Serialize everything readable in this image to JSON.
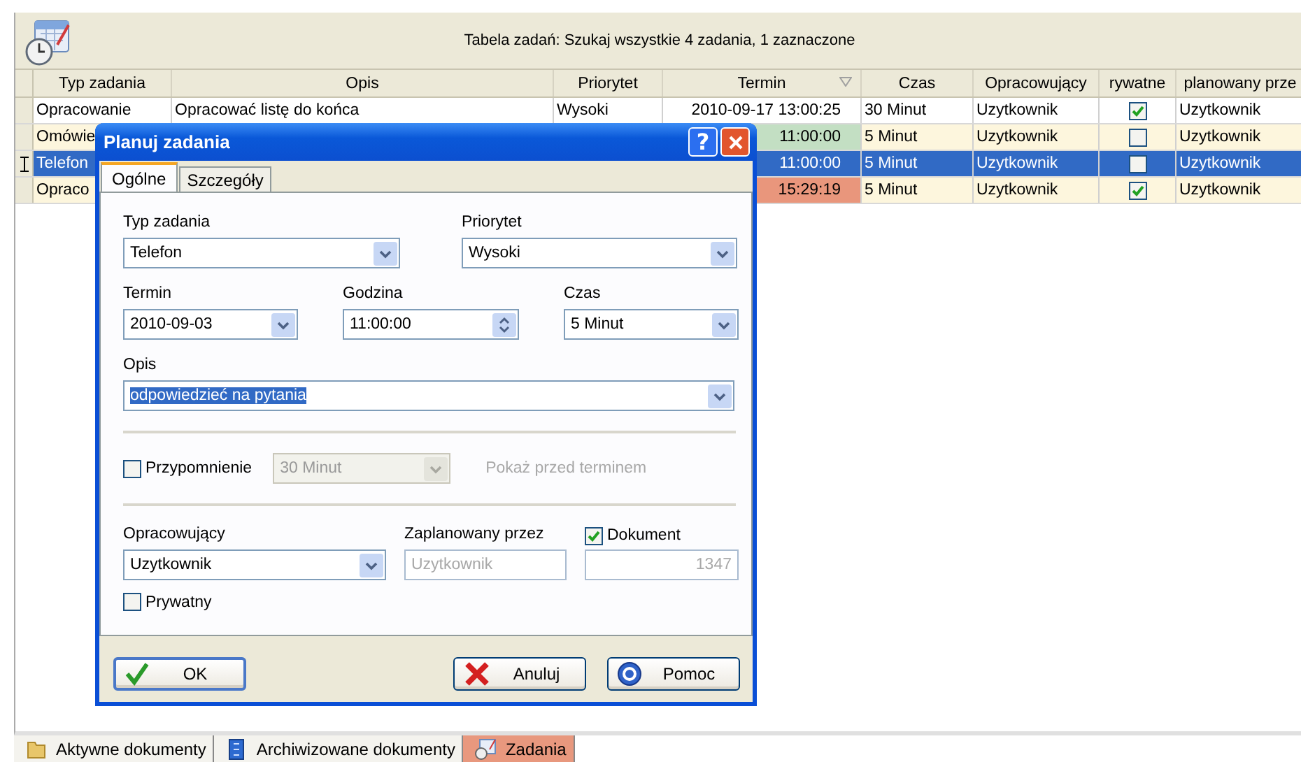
{
  "header": {
    "title": "Tabela zadań: Szukaj wszystkie 4 zadania, 1 zaznaczone"
  },
  "table": {
    "columns": [
      {
        "label": "Typ zadania",
        "sorted": false
      },
      {
        "label": "Opis",
        "sorted": false
      },
      {
        "label": "Priorytet",
        "sorted": false
      },
      {
        "label": "Termin",
        "sorted": true
      },
      {
        "label": "Czas",
        "sorted": false
      },
      {
        "label": "Opracowujący",
        "sorted": false
      },
      {
        "label": "rywatne",
        "sorted": false
      },
      {
        "label": "planowany prze",
        "sorted": false
      }
    ],
    "rows": [
      {
        "typ": "Opracowanie",
        "opis": "Opracować listę do końca",
        "priorytet": "Wysoki",
        "termin": "2010-09-17 13:00:25",
        "czas": "30 Minut",
        "opracowujacy": "Uzytkownik",
        "prywatne": true,
        "planowany": "Uzytkownik",
        "selected": false,
        "current": false
      },
      {
        "typ": "Omówie",
        "termin": "11:00:00",
        "color": "#c3dfc3",
        "czas": "5 Minut",
        "opracowujacy": "Uzytkownik",
        "prywatne": false,
        "planowany": "Uzytkownik",
        "selected": false,
        "current": false
      },
      {
        "typ": "Telefon",
        "termin": "11:00:00",
        "czas": "5 Minut",
        "opracowujacy": "Uzytkownik",
        "prywatne": false,
        "planowany": "Uzytkownik",
        "selected": true,
        "current": true
      },
      {
        "typ": "Opraco",
        "termin": "15:29:19",
        "color": "#e9967c",
        "czas": "5 Minut",
        "opracowujacy": "Uzytkownik",
        "prywatne": true,
        "planowany": "Uzytkownik",
        "selected": false,
        "current": false
      }
    ]
  },
  "dialog": {
    "title": "Planuj zadania",
    "help": "?",
    "tabs": [
      {
        "label": "Ogólne",
        "selected": true
      },
      {
        "label": "Szczegóły",
        "selected": false
      }
    ],
    "typ": {
      "label": "Typ zadania",
      "value": "Telefon"
    },
    "priorytet": {
      "label": "Priorytet",
      "value": "Wysoki"
    },
    "termin": {
      "label": "Termin",
      "value": "2010-09-03"
    },
    "godzina": {
      "label": "Godzina",
      "value": "11:00:00"
    },
    "czas": {
      "label": "Czas",
      "value": "5 Minut"
    },
    "opis": {
      "label": "Opis",
      "value": "odpowiedzieć na pytania"
    },
    "reminder": {
      "label": "Przypomnienie",
      "checked": false,
      "value": "30 Minut",
      "note": "Pokaż przed terminem"
    },
    "opracowujacy": {
      "label": "Opracowujący",
      "value": "Uzytkownik"
    },
    "zaplanowany": {
      "label": "Zaplanowany przez",
      "value": "Uzytkownik",
      "disabled": true
    },
    "dokument": {
      "label": "Dokument",
      "checked": true,
      "value": "1347",
      "disabled": true
    },
    "prywatny": {
      "label": "Prywatny",
      "checked": false
    },
    "buttons": [
      {
        "label": "OK",
        "kind": "ok"
      },
      {
        "label": "Anuluj",
        "kind": "cancel"
      },
      {
        "label": "Pomoc",
        "kind": "help"
      }
    ]
  },
  "bottom_tabs": [
    {
      "label": "Aktywne dokumenty",
      "kind": "folder",
      "selected": false
    },
    {
      "label": "Archiwizowane dokumenty",
      "kind": "archive",
      "selected": false
    },
    {
      "label": "Zadania",
      "kind": "tasks",
      "selected": true
    }
  ]
}
